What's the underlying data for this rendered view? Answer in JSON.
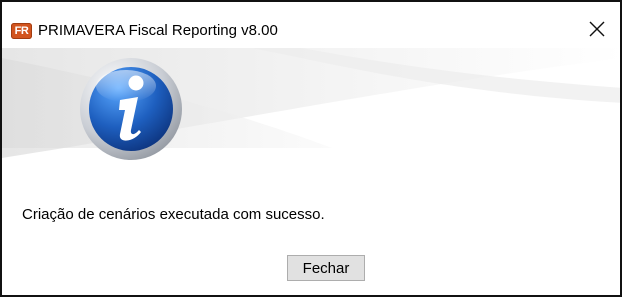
{
  "window": {
    "title": "PRIMAVERA Fiscal Reporting v8.00",
    "app_icon_text": "FR",
    "close_icon": "close-x-icon"
  },
  "dialog": {
    "icon": "information-icon",
    "message": "Criação de cenários executada com sucesso."
  },
  "buttons": {
    "close_label": "Fechar"
  },
  "colors": {
    "app_icon": "#d2541e",
    "info_icon_blue": "#1e5fbf",
    "button_face": "#e1e1e1"
  }
}
